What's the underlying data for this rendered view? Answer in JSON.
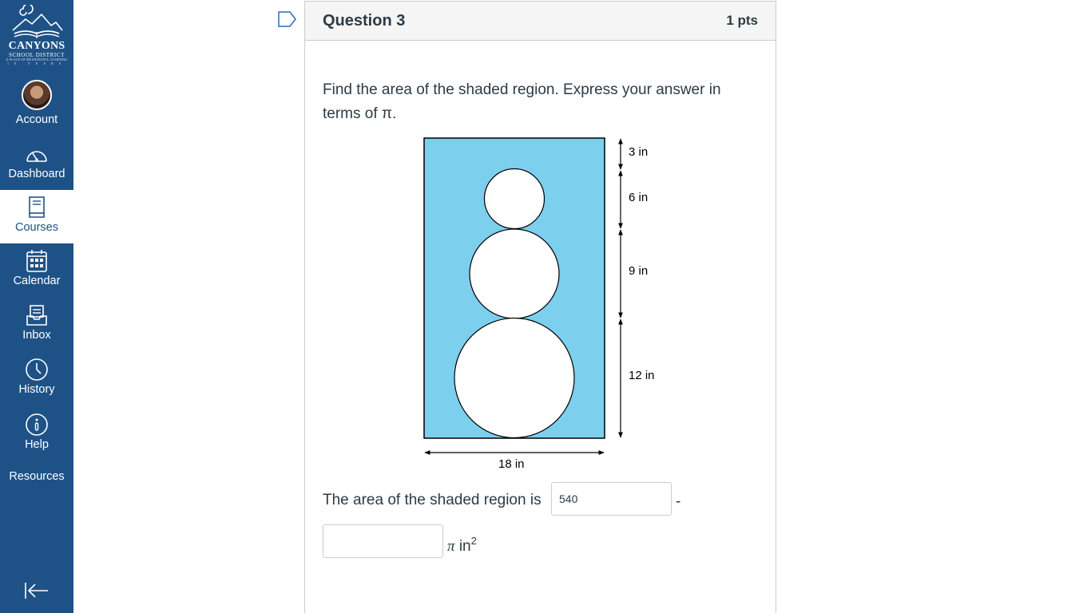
{
  "nav": {
    "logo": {
      "line1": "CANYONS",
      "line2": "SCHOOL DISTRICT",
      "line3": "A PLACE OF MEANINGFUL LEARNING",
      "line4": "10 YEARS"
    },
    "items": [
      {
        "label": "Account",
        "icon": "avatar"
      },
      {
        "label": "Dashboard",
        "icon": "dashboard-icon"
      },
      {
        "label": "Courses",
        "icon": "courses-icon",
        "active": true
      },
      {
        "label": "Calendar",
        "icon": "calendar-icon"
      },
      {
        "label": "Inbox",
        "icon": "inbox-icon"
      },
      {
        "label": "History",
        "icon": "clock-icon"
      },
      {
        "label": "Help",
        "icon": "help-icon"
      },
      {
        "label": "Resources",
        "icon": ""
      }
    ],
    "collapse_icon": "collapse-nav-icon"
  },
  "question": {
    "title": "Question 3",
    "points": "1 pts",
    "text": "Find the area of the shaded region. Express your answer in terms of π.",
    "figure": {
      "labels": {
        "top_gap": "3 in",
        "small_circle": "6 in",
        "medium_circle": "9 in",
        "large_circle": "12 in",
        "width": "18 in"
      },
      "diameters_in": [
        6,
        9,
        12
      ],
      "rect_in": {
        "width": 18,
        "height": 30
      },
      "shade_color": "#7dcfee"
    },
    "answer_prefix": "The area of the shaded region is",
    "answer1_value": "540",
    "separator": "-",
    "answer2_value": "",
    "unit_pi": "π",
    "unit_in": "in",
    "unit_exp": "2"
  },
  "colors": {
    "nav_bg": "#1e5287",
    "card_border": "#c7cdd1",
    "header_bg": "#f5f5f5",
    "text": "#2d3b45"
  }
}
